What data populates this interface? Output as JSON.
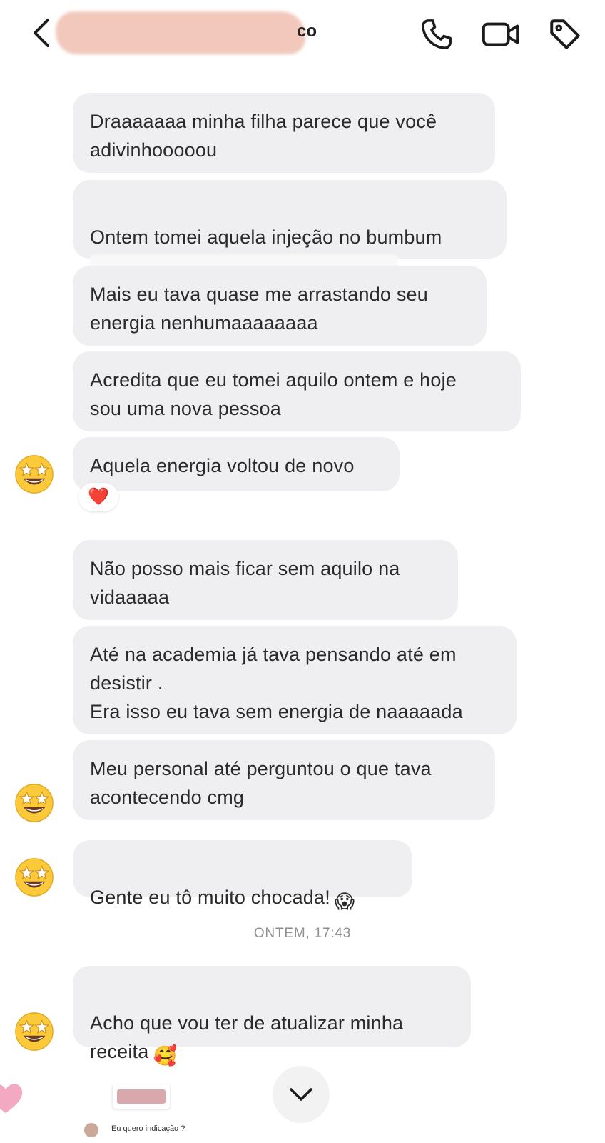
{
  "header": {
    "name_suffix": "co",
    "icons": [
      "chevron-left-icon",
      "phone-icon",
      "video-camera-icon",
      "tag-icon"
    ]
  },
  "messages": [
    {
      "text": "Draaaaaaa minha filha parece que você\nadivinhooooou"
    },
    {
      "text": "Ontem tomei aquela injeção no bumbum"
    },
    {
      "text": "Mais eu tava quase me arrastando seu\nenergia nenhumaaaaaaaa"
    },
    {
      "text": "Acredita que eu tomei aquilo ontem e hoje\nsou uma nova pessoa"
    },
    {
      "text": "Aquela energia voltou de novo",
      "reaction": "❤️"
    },
    {
      "text": "Não posso mais ficar sem aquilo na\nvidaaaaa"
    },
    {
      "text": "Até na academia já tava pensando até em\ndesistir .\nEra isso eu tava sem energia de naaaaada"
    },
    {
      "text": "Meu personal até perguntou o que tava\nacontecendo cmg"
    },
    {
      "text": "Gente eu tô muito chocada!",
      "emoji": "😱"
    },
    {
      "text": "Acho que vou ter de atualizar minha\nreceita",
      "emoji": "🥰"
    }
  ],
  "timestamp": "ONTEM, 17:43",
  "avatar_emoji": "🤩",
  "bottom": {
    "caption": "Eu quero indicação ?"
  },
  "colors": {
    "bubble_bg": "#efeff1",
    "text": "#2a2a2a",
    "timestamp": "#8e8e8e",
    "redaction": "#f1c6b8"
  }
}
